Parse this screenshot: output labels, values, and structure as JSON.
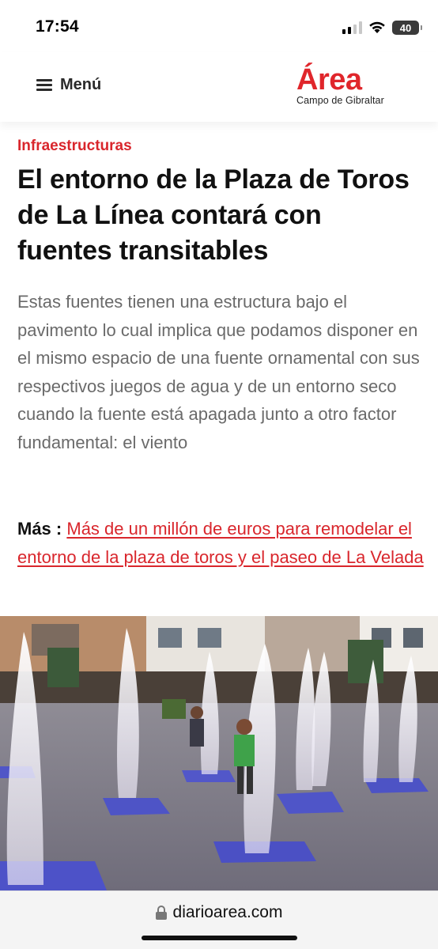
{
  "status_bar": {
    "time": "17:54",
    "battery": "40",
    "icons": [
      "signal-icon",
      "wifi-icon",
      "battery-icon"
    ]
  },
  "header": {
    "menu_label": "Menú",
    "menu_icon": "hamburger-icon",
    "logo_text": "Área",
    "logo_subtitle": "Campo de Gibraltar"
  },
  "article": {
    "category": "Infraestructuras",
    "headline": "El entorno de la Plaza de Toros de La Línea contará con fuentes transitables",
    "lead": "Estas fuentes tienen una estructura bajo el pavimento lo cual implica que podamos disponer en el mismo espacio de una fuente ornamental con sus respectivos juegos de agua y de un entorno seco cuando la fuente está apagada junto a otro factor fundamental: el viento",
    "more_label": "Más :",
    "more_link": "Más de un millón de euros para remodelar el entorno de la plaza de toros y el paseo de La Velada"
  },
  "browser": {
    "url": "diarioarea.com"
  },
  "colors": {
    "brand_red": "#e0262b",
    "category_red": "#d9262c",
    "lead_gray": "#6a6a6a"
  }
}
